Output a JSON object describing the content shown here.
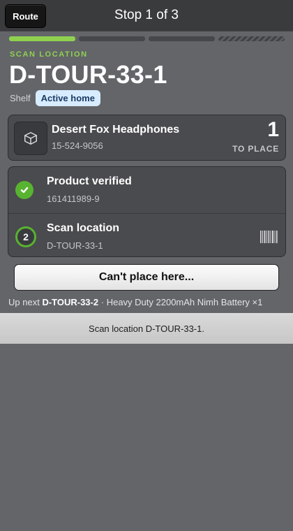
{
  "header": {
    "route_label": "Route",
    "title": "Stop 1 of 3"
  },
  "progress": {
    "segments": [
      "done",
      "todo",
      "todo",
      "pending"
    ]
  },
  "location": {
    "section_label": "SCAN LOCATION",
    "code": "D-TOUR-33-1",
    "type_label": "Shelf",
    "badge": "Active home"
  },
  "product": {
    "icon": "box-icon",
    "name": "Desert Fox Headphones",
    "sku": "15-524-9056",
    "quantity": "1",
    "quantity_label": "TO PLACE"
  },
  "steps": [
    {
      "status": "complete",
      "title": "Product verified",
      "subtitle": "161411989-9"
    },
    {
      "status": "current",
      "number": "2",
      "title": "Scan location",
      "subtitle": "D-TOUR-33-1",
      "action_icon": "barcode-icon"
    }
  ],
  "cant_place_label": "Can't place here...",
  "up_next": {
    "prefix": "Up next",
    "location": "D-TOUR-33-2",
    "separator": "·",
    "item": "Heavy Duty 2200mAh Nimh Battery ×1"
  },
  "status_message": "Scan location D-TOUR-33-1.",
  "colors": {
    "accent_green": "#8fd14f",
    "success_green": "#58b331",
    "badge_bg": "#d7ecff",
    "background": "#636569"
  }
}
